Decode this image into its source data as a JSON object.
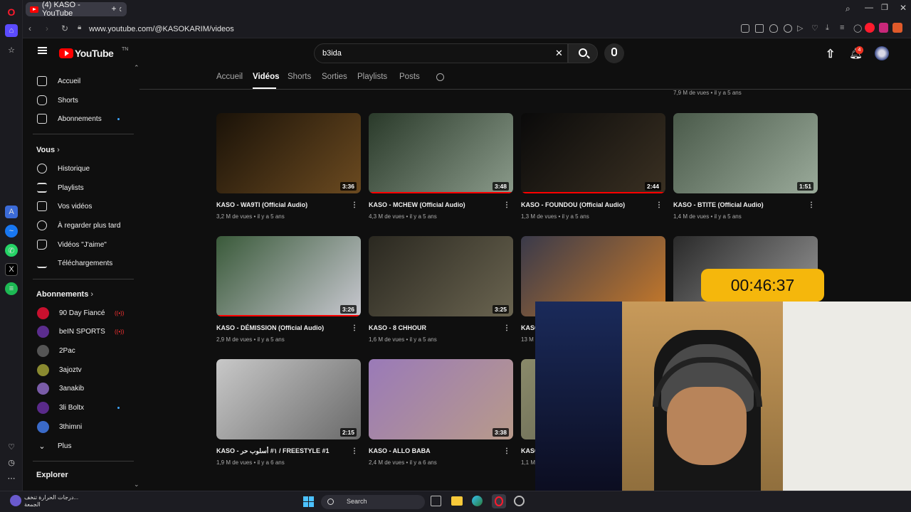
{
  "browser": {
    "tab_title": "(4) KASO - YouTube",
    "new_tab": "+",
    "url": "www.youtube.com/@KASOKARIM/videos"
  },
  "header": {
    "logo_text": "YouTube",
    "logo_country": "TN",
    "search_value": "b3ida",
    "clear_glyph": "✕",
    "notif_count": "4"
  },
  "sidebar": {
    "main": [
      {
        "label": "Accueil"
      },
      {
        "label": "Shorts"
      },
      {
        "label": "Abonnements"
      }
    ],
    "you_heading": "Vous",
    "you_items": [
      {
        "label": "Historique"
      },
      {
        "label": "Playlists"
      },
      {
        "label": "Vos vidéos"
      },
      {
        "label": "À regarder plus tard"
      },
      {
        "label": "Vidéos \"J'aime\""
      },
      {
        "label": "Téléchargements"
      }
    ],
    "subs_heading": "Abonnements",
    "subs": [
      {
        "label": "90 Day Fiancé",
        "color": "#c8102e"
      },
      {
        "label": "beIN SPORTS",
        "color": "#5b2d8e"
      },
      {
        "label": "2Pac",
        "color": "#555555"
      },
      {
        "label": "3ajoztv",
        "color": "#8a8a30"
      },
      {
        "label": "3anakib",
        "color": "#7a5ca8"
      },
      {
        "label": "3li Boltx",
        "color": "#5a2a8a"
      },
      {
        "label": "3thimni",
        "color": "#3a6ac8"
      }
    ],
    "more_label": "Plus",
    "explore_heading": "Explorer"
  },
  "channel_tabs": [
    "Accueil",
    "Vidéos",
    "Shorts",
    "Sorties",
    "Playlists",
    "Posts"
  ],
  "top_meta": "7,9 M de vues • il y a 5 ans",
  "videos": [
    {
      "title": "KASO - WA9TI (Official Audio)",
      "meta": "3,2 M de vues • il y a 5 ans",
      "duration": "3:36",
      "watched": 0,
      "c1": "#1a1208",
      "c2": "#6b4a20"
    },
    {
      "title": "KASO - MCHEW (Official Audio)",
      "meta": "4,3 M de vues • il y a 5 ans",
      "duration": "3:48",
      "watched": 1,
      "c1": "#2a3a2a",
      "c2": "#8a9a8a"
    },
    {
      "title": "KASO - FOUNDOU (Official Audio)",
      "meta": "1,3 M de vues • il y a 5 ans",
      "duration": "2:44",
      "watched": 1,
      "c1": "#0a0a0a",
      "c2": "#3a3022"
    },
    {
      "title": "KASO - BTITE (Official Audio)",
      "meta": "1,4 M de vues • il y a 5 ans",
      "duration": "1:51",
      "watched": 0,
      "c1": "#4a5a4a",
      "c2": "#9aaa9a"
    },
    {
      "title": "KASO - DÉMISSION (Official Audio)",
      "meta": "2,9 M de vues • il y a 5 ans",
      "duration": "3:26",
      "watched": 1,
      "c1": "#3a5a3a",
      "c2": "#c8c8d0"
    },
    {
      "title": "KASO - 8 CHHOUR",
      "meta": "1,6 M de vues • il y a 5 ans",
      "duration": "3:25",
      "watched": 0,
      "c1": "#2a2820",
      "c2": "#6a6450"
    },
    {
      "title": "KASO - BOUZAYEN",
      "meta": "13 M de vues • il y a 5 ans",
      "duration": "",
      "watched": 0,
      "c1": "#3a3a4a",
      "c2": "#c87a2a"
    },
    {
      "title": "",
      "meta": "",
      "duration": "",
      "watched": 0,
      "c1": "#2a2a2a",
      "c2": "#9a9a9a"
    },
    {
      "title": "KASO - ١# أسلوب حر / FREESTYLE #1",
      "meta": "1,9 M de vues • il y a 6 ans",
      "duration": "2:15",
      "watched": 0,
      "c1": "#c8c8c8",
      "c2": "#6a6a6a"
    },
    {
      "title": "KASO - ALLO BABA",
      "meta": "2,4 M de vues • il y a 6 ans",
      "duration": "3:38",
      "watched": 0,
      "c1": "#9a7ab8",
      "c2": "#b89a8a"
    },
    {
      "title": "KASO",
      "meta": "1,1 M",
      "duration": "",
      "watched": 0,
      "c1": "#8a8a6a",
      "c2": "#5a5a4a"
    }
  ],
  "overlay": {
    "timer": "00:46:37"
  },
  "taskbar": {
    "weather_line1": "درجات الحرارة تنخف...",
    "weather_line2": "الجمعة",
    "search_label": "Search"
  }
}
